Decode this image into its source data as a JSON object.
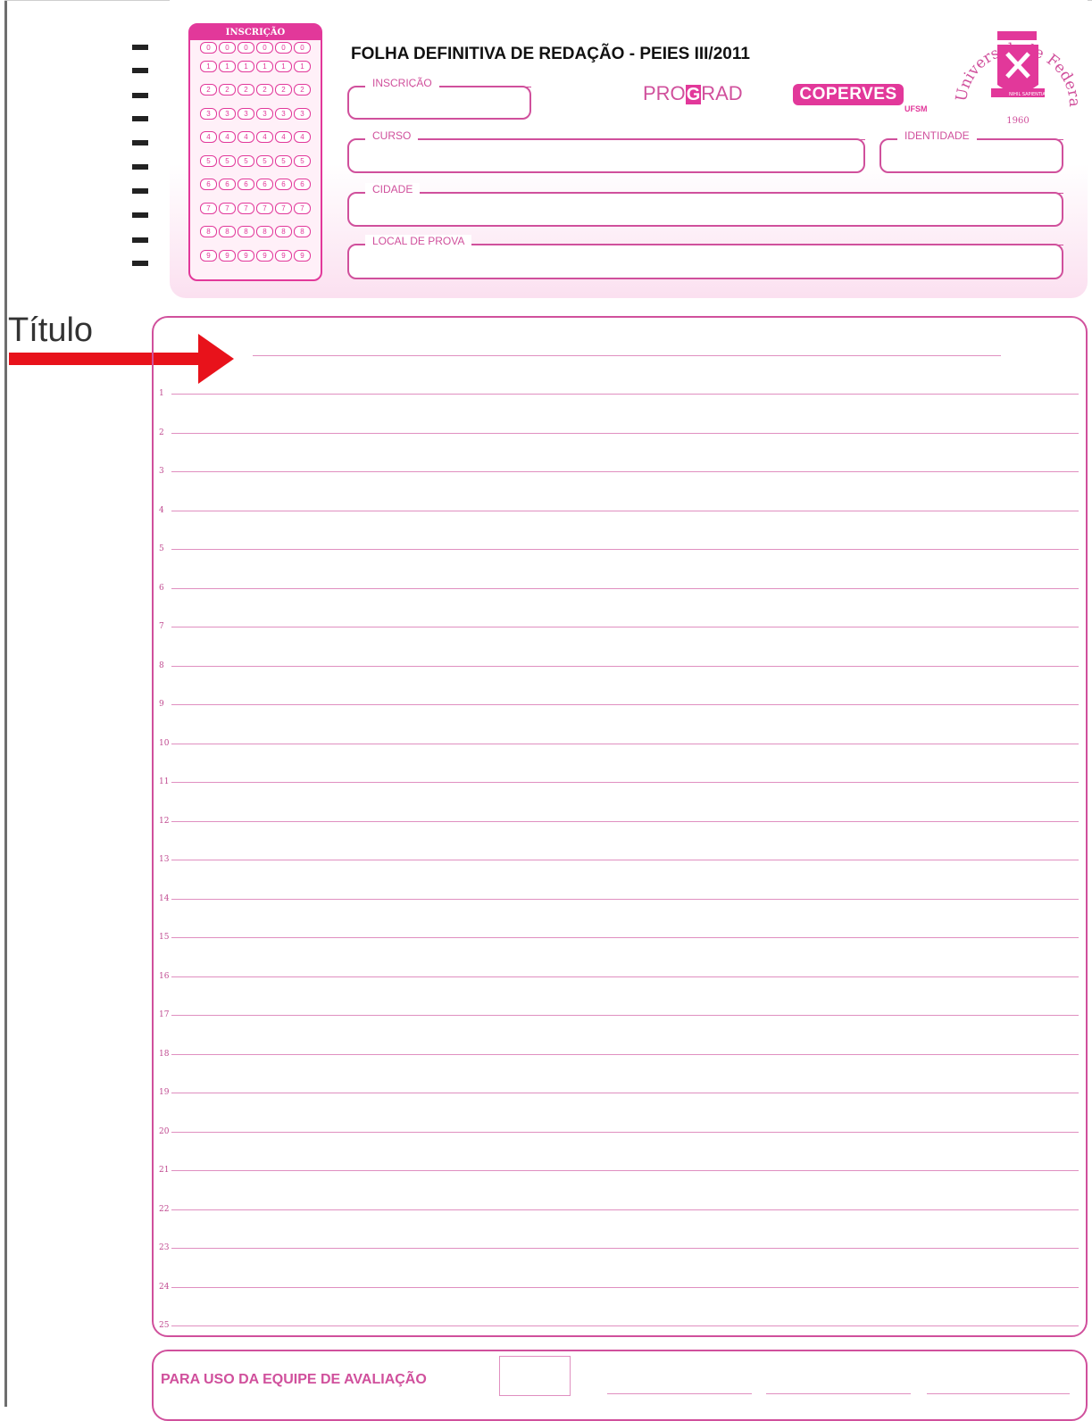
{
  "form": {
    "title": "FOLHA DEFINITIVA DE REDAÇÃO - PEIES III/2011",
    "bubble_grid": {
      "title": "INSCRIÇÃO",
      "digits": [
        "0",
        "1",
        "2",
        "3",
        "4",
        "5",
        "6",
        "7",
        "8",
        "9"
      ],
      "columns": 6
    },
    "fields": {
      "inscricao": "INSCRIÇÃO",
      "curso": "CURSO",
      "identidade": "IDENTIDADE",
      "cidade": "CIDADE",
      "local_de_prova": "LOCAL DE PROVA"
    },
    "logos": {
      "prograd_pre": "PRO",
      "prograd_g": "G",
      "prograd_post": "RAD",
      "coperves": "COPERVES",
      "ufsm": "UFSM",
      "seal_text": "Universidade Federal de Santa Maria",
      "seal_year": "1960",
      "seal_motto": "NIHIL SAPIENTIAE"
    },
    "accent_color": "#e2389a",
    "line_color": "#d0509c"
  },
  "annotation": {
    "label": "Título",
    "arrow_color": "#e8121b"
  },
  "essay": {
    "line_numbers": [
      "1",
      "2",
      "3",
      "4",
      "5",
      "6",
      "7",
      "8",
      "9",
      "10",
      "11",
      "12",
      "13",
      "14",
      "15",
      "16",
      "17",
      "18",
      "19",
      "20",
      "21",
      "22",
      "23",
      "24",
      "25"
    ]
  },
  "evaluation": {
    "label": "PARA USO DA EQUIPE DE AVALIAÇÃO"
  }
}
